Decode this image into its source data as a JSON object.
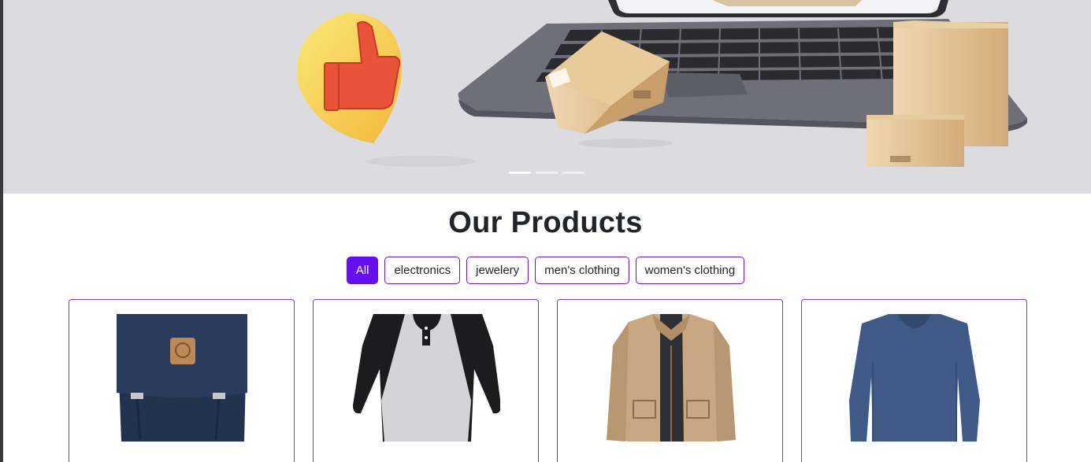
{
  "hero": {
    "slides": [
      {
        "name": "slide-1",
        "active": true
      },
      {
        "name": "slide-2",
        "active": false
      },
      {
        "name": "slide-3",
        "active": false
      }
    ],
    "colors": {
      "background": "#dcdce0",
      "laptop": "#6d6d78",
      "box": "#d9b88a",
      "thumb_bubble": "#f6d34a",
      "thumb": "#e8533a"
    }
  },
  "products": {
    "title": "Our Products",
    "filters": [
      {
        "label": "All",
        "active": true
      },
      {
        "label": "electronics",
        "active": false
      },
      {
        "label": "jewelery",
        "active": false
      },
      {
        "label": "men's clothing",
        "active": false
      },
      {
        "label": "women's clothing",
        "active": false
      }
    ],
    "items": [
      {
        "image": "navy-backpack-icon"
      },
      {
        "image": "raglan-tshirt-icon"
      },
      {
        "image": "khaki-jacket-icon"
      },
      {
        "image": "blue-longsleeve-icon"
      }
    ]
  },
  "theme": {
    "accent": "#6610f2",
    "text": "#212529"
  }
}
